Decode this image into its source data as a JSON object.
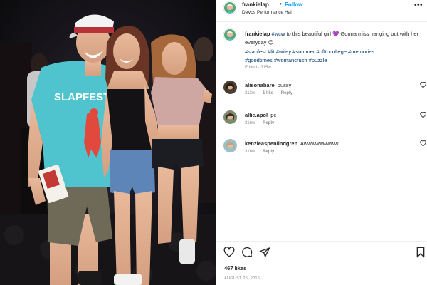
{
  "post": {
    "username": "frankielap",
    "follow_dot": "•",
    "follow_label": "Follow",
    "location": "DeVos Performance Hall",
    "more_label": "•••"
  },
  "caption": {
    "username": "frankielap",
    "mention": "#wcw",
    "text_a": " to this beautiful girl ",
    "heart": "💜",
    "text_b": " Gonna miss hanging out with her everyday ",
    "emoji": "😊",
    "hashtags": [
      "#slapfest",
      "#lit",
      "#wifey",
      "#summer",
      "#offtocollege",
      "#memories",
      "#goodtimes",
      "#womancrush",
      "#puzzle"
    ],
    "edited": "Edited · 315w"
  },
  "comments": [
    {
      "username": "alisonabare",
      "text": "pussy",
      "time": "313w",
      "likes": "1 like",
      "reply": "Reply",
      "avatar_color": "#6b5a48"
    },
    {
      "username": "allie.apol",
      "text": "pc",
      "time": "316w",
      "likes": "",
      "reply": "Reply",
      "avatar_color": "#7a8a6a"
    },
    {
      "username": "kenzieaspenlindgren",
      "text": "Awwwwwwwww",
      "time": "316w",
      "likes": "",
      "reply": "Reply",
      "avatar_color": "#c9a27a"
    }
  ],
  "footer": {
    "likes": "467 likes",
    "date": "AUGUST 25, 2016"
  },
  "photo": {
    "shirt_text": "SLAPFEST"
  },
  "colors": {
    "link_blue": "#0095f6",
    "hashtag_blue": "#00376b",
    "muted": "#8e8e8e",
    "text": "#262626",
    "shirt": "#4cc3d0"
  },
  "icons": {
    "like": "heart-outline-icon",
    "comment": "comment-icon",
    "share": "paper-plane-icon",
    "save": "bookmark-icon"
  }
}
